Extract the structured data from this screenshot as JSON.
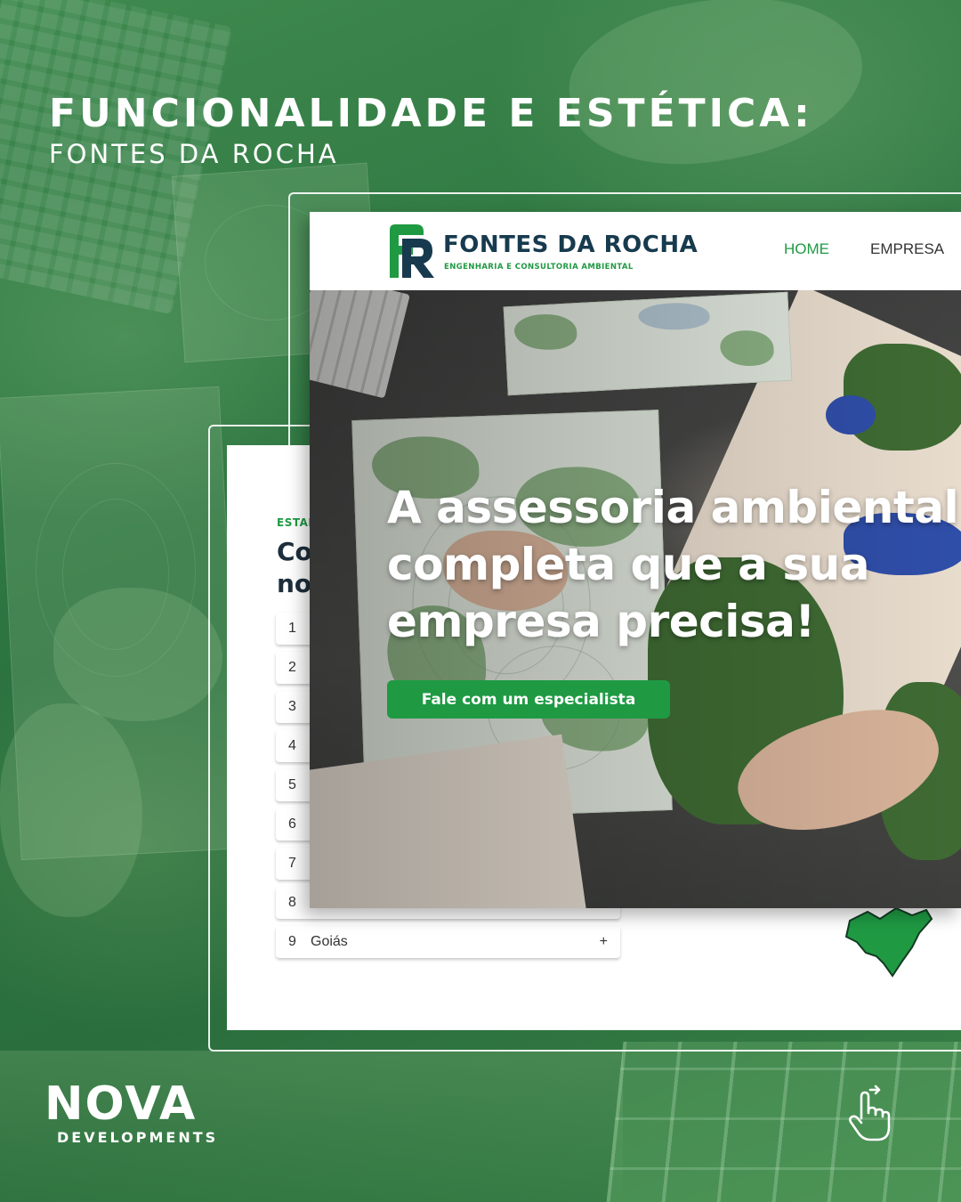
{
  "headline": {
    "title": "FUNCIONALIDADE E ESTÉTICA:",
    "subtitle": "FONTES DA ROCHA"
  },
  "website": {
    "logo": {
      "name": "FONTES DA ROCHA",
      "tagline": "ENGENHARIA E CONSULTORIA AMBIENTAL"
    },
    "nav": [
      {
        "label": "HOME",
        "active": true
      },
      {
        "label": "EMPRESA",
        "active": false
      }
    ],
    "hero": {
      "title": "A assessoria ambiental completa que a sua empresa precisa!",
      "cta": "Fale com um especialista"
    }
  },
  "states_section": {
    "eyebrow": "ESTAD",
    "title_line1": "Co",
    "title_line2": "no",
    "items": [
      {
        "number": "1",
        "name": "",
        "action": ""
      },
      {
        "number": "2",
        "name": "",
        "action": ""
      },
      {
        "number": "3",
        "name": "",
        "action": ""
      },
      {
        "number": "4",
        "name": "",
        "action": ""
      },
      {
        "number": "5",
        "name": "",
        "action": ""
      },
      {
        "number": "6",
        "name": "",
        "action": ""
      },
      {
        "number": "7",
        "name": "",
        "action": ""
      },
      {
        "number": "8",
        "name": "",
        "action": ""
      },
      {
        "number": "9",
        "name": "Goiás",
        "action": "+"
      }
    ]
  },
  "brand": {
    "name": "NOVA",
    "sub": "DEVELOPMENTS"
  },
  "colors": {
    "accent_green": "#1f9a43",
    "logo_navy": "#173a4e",
    "background_green": "#2f7a42"
  },
  "icons": {
    "tap": "tap-hand-icon",
    "logo": "fr-logo-icon",
    "map": "state-map-icon"
  }
}
